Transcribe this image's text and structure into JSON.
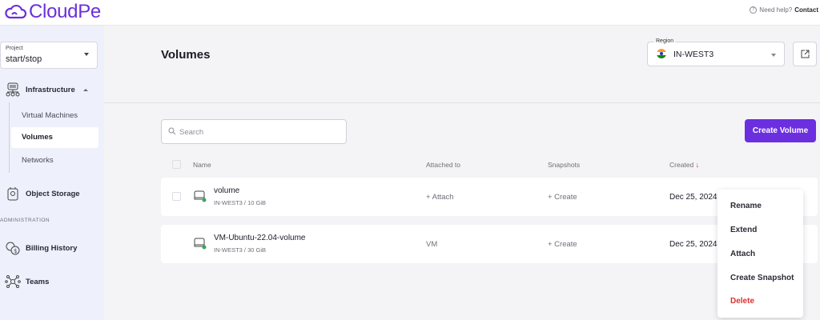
{
  "brand": {
    "name": "CloudPe"
  },
  "help": {
    "text": "Need help?",
    "link": "Contact"
  },
  "project": {
    "label": "Project",
    "value": "start/stop"
  },
  "sidebar": {
    "infrastructure": "Infrastructure",
    "sub_items": [
      "Virtual Machines",
      "Volumes",
      "Networks"
    ],
    "object_storage": "Object Storage",
    "admin_label": "ADMINISTRATION",
    "billing": "Billing History",
    "teams": "Teams"
  },
  "page": {
    "title": "Volumes"
  },
  "region": {
    "label": "Region",
    "value": "IN-WEST3"
  },
  "search": {
    "placeholder": "Search"
  },
  "create_button": "Create Volume",
  "table": {
    "headers": {
      "name": "Name",
      "attached": "Attached to",
      "snapshots": "Snapshots",
      "created": "Created",
      "sort_arrow": "↓"
    },
    "rows": [
      {
        "name": "volume",
        "sub": "IN-WEST3 / 10 GiB",
        "attached": "+ Attach",
        "snapshots": "+ Create",
        "created": "Dec 25, 2024"
      },
      {
        "name": "VM-Ubuntu-22.04-volume",
        "sub": "IN-WEST3 / 30 GiB",
        "attached": "VM",
        "snapshots": "+ Create",
        "created": "Dec 25, 2024"
      }
    ]
  },
  "context_menu": [
    "Rename",
    "Extend",
    "Attach",
    "Create Snapshot",
    "Delete"
  ],
  "colors": {
    "accent": "#6b2fe0",
    "danger": "#d9322f",
    "sidebar_bg": "#eef0fb"
  }
}
